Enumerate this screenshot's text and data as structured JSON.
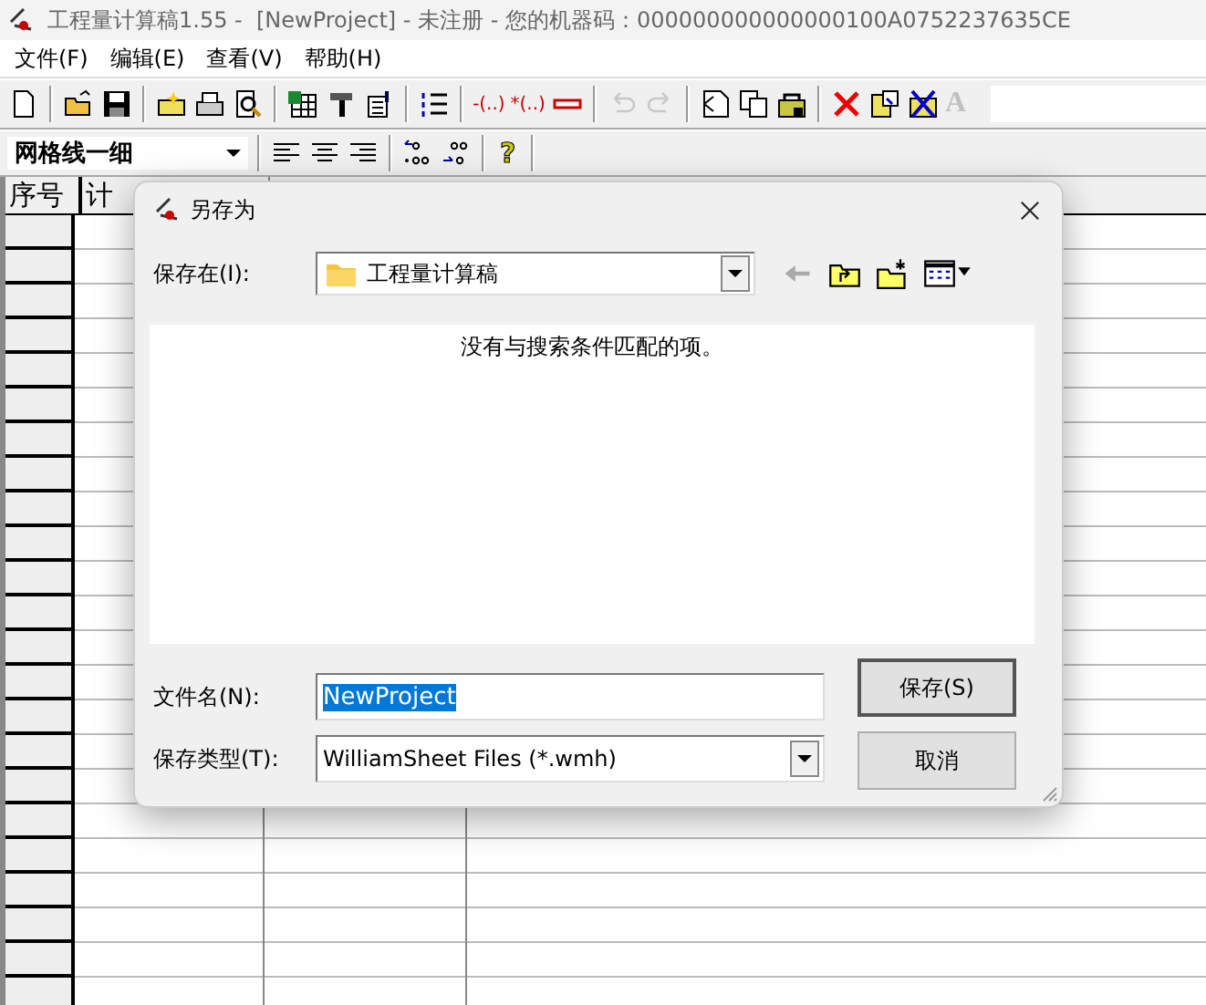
{
  "window": {
    "title": "工程量计算稿1.55 -  [NewProject] - 未注册 - 您的机器码：000000000000000100A0752237635CE"
  },
  "menu": [
    "文件(F)",
    "编辑(E)",
    "查看(V)",
    "帮助(H)"
  ],
  "toolbar": [
    {
      "kind": "new",
      "disabled": false
    },
    {
      "kind": "sep"
    },
    {
      "kind": "open",
      "disabled": false
    },
    {
      "kind": "save",
      "disabled": false
    },
    {
      "kind": "sep"
    },
    {
      "kind": "wizard",
      "disabled": false
    },
    {
      "kind": "print",
      "disabled": false
    },
    {
      "kind": "preview",
      "disabled": false
    },
    {
      "kind": "sep"
    },
    {
      "kind": "sheet",
      "disabled": false
    },
    {
      "kind": "tools",
      "disabled": false
    },
    {
      "kind": "props",
      "disabled": false
    },
    {
      "kind": "sep"
    },
    {
      "kind": "list",
      "disabled": false
    },
    {
      "kind": "sep"
    },
    {
      "kind": "text",
      "label": "-(..)",
      "disabled": false
    },
    {
      "kind": "text",
      "label": "*(..)",
      "disabled": false
    },
    {
      "kind": "insert",
      "disabled": false
    },
    {
      "kind": "sep"
    },
    {
      "kind": "undo",
      "disabled": true
    },
    {
      "kind": "redo",
      "disabled": true
    },
    {
      "kind": "sep"
    },
    {
      "kind": "block",
      "disabled": false
    },
    {
      "kind": "copy",
      "disabled": false
    },
    {
      "kind": "lock",
      "disabled": false
    },
    {
      "kind": "sep"
    },
    {
      "kind": "delete",
      "disabled": false
    },
    {
      "kind": "paste",
      "disabled": false
    },
    {
      "kind": "clear",
      "disabled": false
    },
    {
      "kind": "font",
      "label": "A",
      "disabled": true
    }
  ],
  "format_bar": {
    "line_style": "网格线一细",
    "help": "?"
  },
  "grid": {
    "columns": [
      "序号",
      "计"
    ]
  },
  "dialog": {
    "title": "另存为",
    "save_in_label": "保存在(I):",
    "save_in_value": "工程量计算稿",
    "empty_message": "没有与搜索条件匹配的项。",
    "file_name_label": "文件名(N):",
    "file_name_value": "NewProject",
    "file_type_label": "保存类型(T):",
    "file_type_value": "WilliamSheet Files (*.wmh)",
    "buttons": [
      "保存(S)",
      "取消"
    ]
  }
}
